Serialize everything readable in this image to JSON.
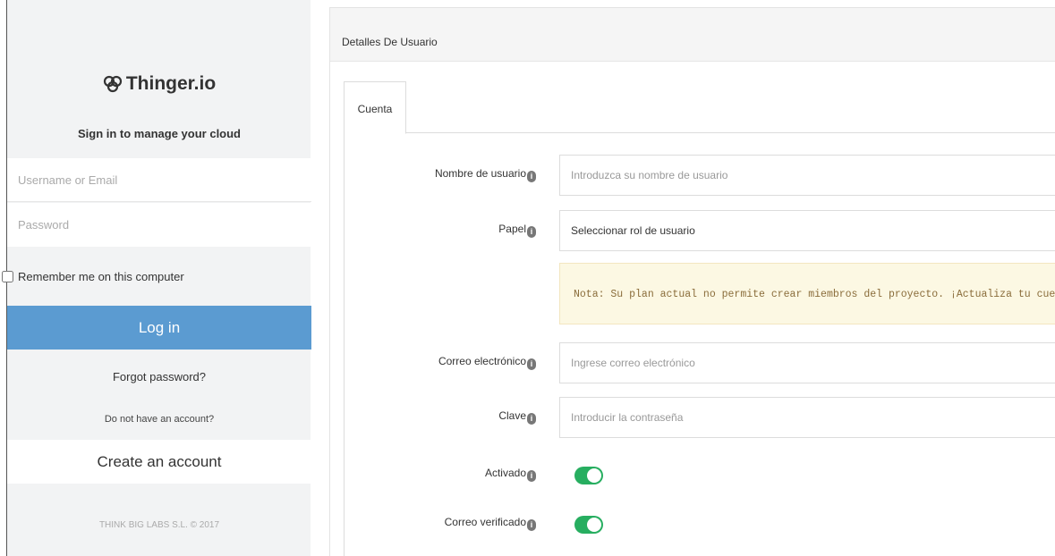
{
  "login": {
    "brand": "Thinger.io",
    "subtitle": "Sign in to manage your cloud",
    "username_placeholder": "Username or Email",
    "password_placeholder": "Password",
    "remember_label": "Remember me on this computer",
    "login_button": "Log in",
    "forgot_password": "Forgot password?",
    "no_account": "Do not have an account?",
    "create_account": "Create an account",
    "footer": "THINK BIG LABS S.L. © 2017"
  },
  "details": {
    "header": "Detalles De Usuario",
    "tab": "Cuenta",
    "fields": {
      "username_label": "Nombre de usuario",
      "username_placeholder": "Introduzca su nombre de usuario",
      "role_label": "Papel",
      "role_value": "Seleccionar rol de usuario",
      "warning": "Nota: Su plan actual no permite crear miembros del proyecto. ¡Actualiza tu cuenta",
      "email_label": "Correo electrónico",
      "email_placeholder": "Ingrese correo electrónico",
      "password_label": "Clave",
      "password_placeholder": "Introducir la contraseña",
      "enabled_label": "Activado",
      "verified_label": "Correo verificado"
    },
    "enabled": true,
    "verified": true,
    "toggle_color": "#27ae60"
  }
}
